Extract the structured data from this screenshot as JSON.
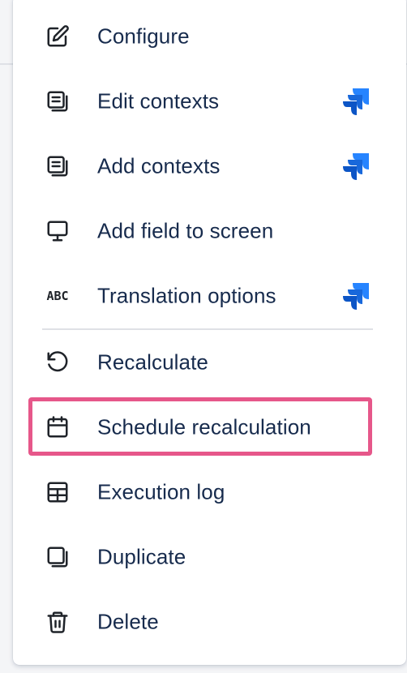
{
  "menu": {
    "items": [
      {
        "label": "Configure",
        "icon": "edit-icon",
        "badge": false
      },
      {
        "label": "Edit contexts",
        "icon": "copy-list-icon",
        "badge": true
      },
      {
        "label": "Add contexts",
        "icon": "copy-list-icon",
        "badge": true
      },
      {
        "label": "Add field to screen",
        "icon": "monitor-icon",
        "badge": false
      },
      {
        "label": "Translation options",
        "icon": "abc-icon",
        "icon_text": "ABC",
        "badge": true
      },
      {
        "label": "Recalculate",
        "icon": "undo-icon",
        "badge": false
      },
      {
        "label": "Schedule recalculation",
        "icon": "calendar-icon",
        "badge": false,
        "highlighted": true
      },
      {
        "label": "Execution log",
        "icon": "table-icon",
        "badge": false
      },
      {
        "label": "Duplicate",
        "icon": "duplicate-icon",
        "badge": false
      },
      {
        "label": "Delete",
        "icon": "trash-icon",
        "badge": false
      }
    ]
  },
  "colors": {
    "text": "#172b4d",
    "highlight": "#e6578a",
    "jira_badge": "#2684ff",
    "divider": "#dfe1e6"
  }
}
